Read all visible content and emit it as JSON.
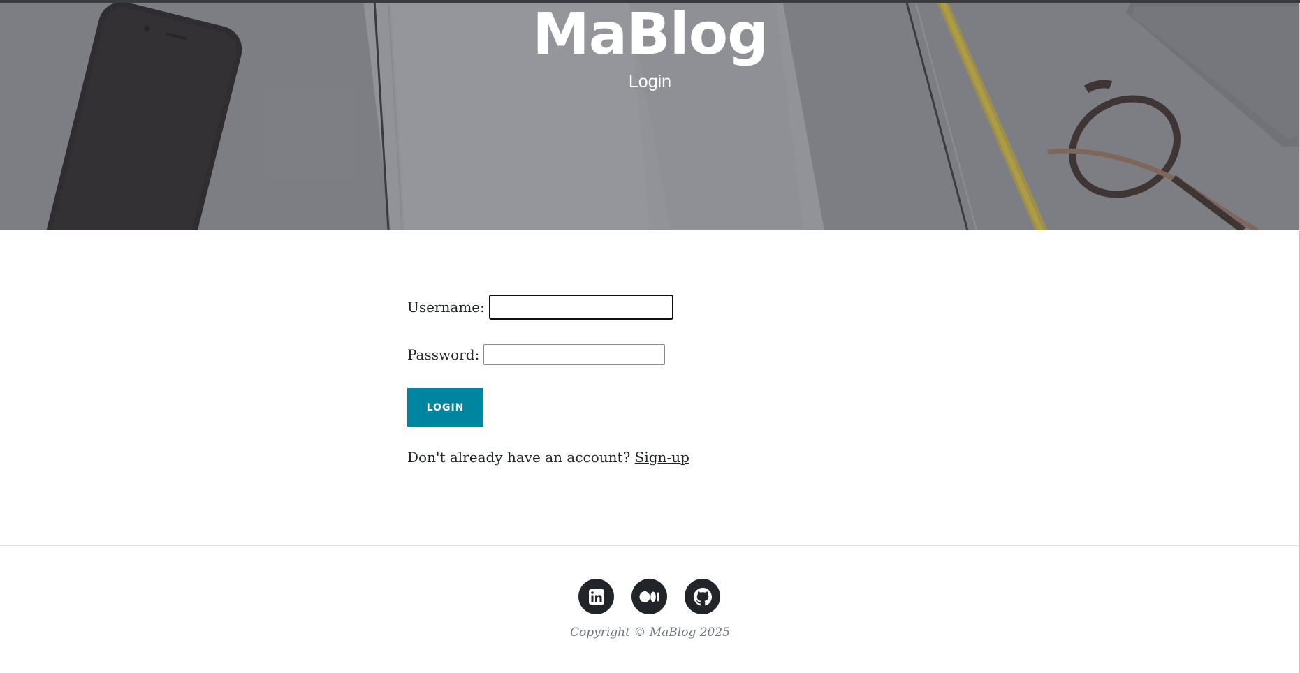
{
  "header": {
    "site_title": "MaBlog",
    "subtitle": "Login"
  },
  "login_form": {
    "username_label": "Username:",
    "username_value": "",
    "password_label": "Password:",
    "password_value": "",
    "submit_label": "Login",
    "signup_prompt": "Don't already have an account?",
    "signup_link": "Sign-up"
  },
  "footer": {
    "social_icons": [
      "linkedin-icon",
      "medium-icon",
      "github-icon"
    ],
    "copyright": "Copyright © MaBlog 2025"
  },
  "colors": {
    "accent": "#0085a1",
    "text": "#212529",
    "muted": "#6c757d"
  }
}
